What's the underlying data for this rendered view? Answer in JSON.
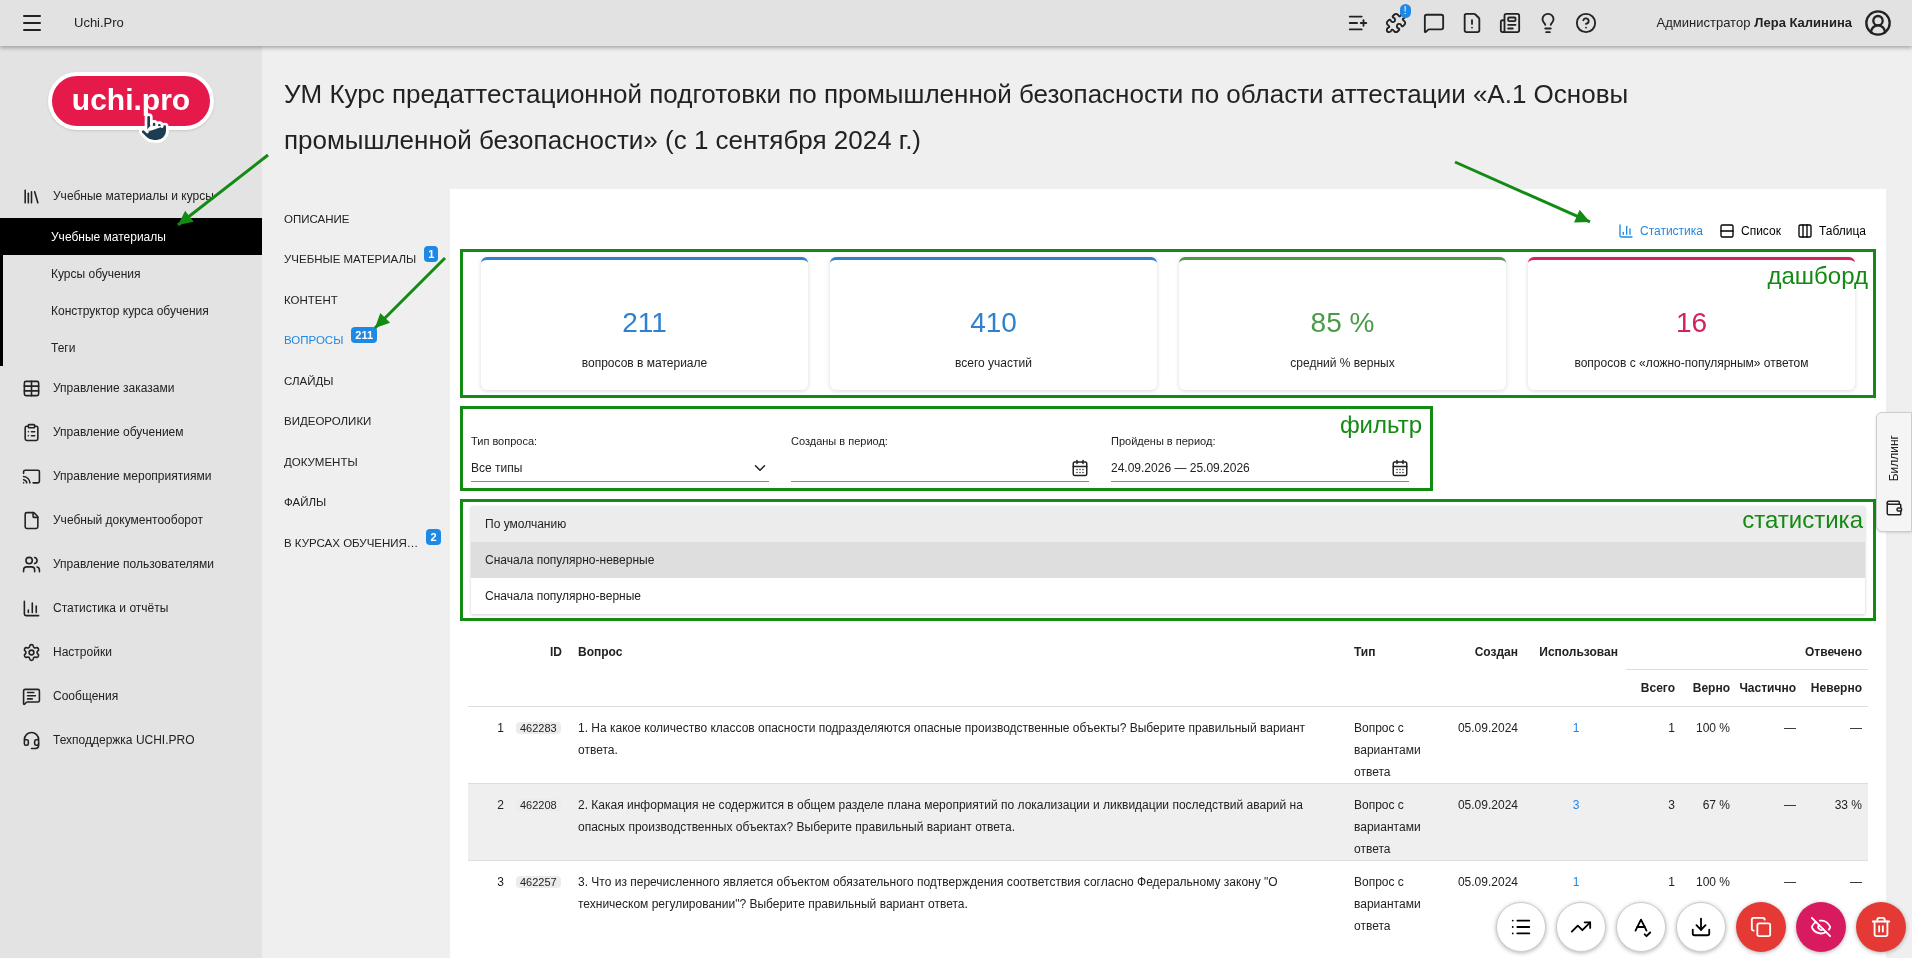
{
  "topbar": {
    "app_name": "Uchi.Pro",
    "icons": [
      {
        "kind": "list-add"
      },
      {
        "kind": "puzzle",
        "badge": "!"
      },
      {
        "kind": "message"
      },
      {
        "kind": "alert-doc"
      },
      {
        "kind": "news"
      },
      {
        "kind": "bulb"
      },
      {
        "kind": "help"
      }
    ],
    "user_role": "Администратор",
    "user_name": "Лера Калинина"
  },
  "logo": {
    "text": "uchi.pro"
  },
  "sidebar": {
    "items": [
      {
        "label": "Учебные материалы и курсы",
        "kind": "library",
        "selected": false,
        "children": [
          {
            "label": "Учебные материалы",
            "selected": true
          },
          {
            "label": "Курсы обучения",
            "selected": false
          },
          {
            "label": "Конструктор курса обучения",
            "selected": false
          },
          {
            "label": "Теги",
            "selected": false
          }
        ]
      },
      {
        "label": "Управление заказами",
        "kind": "table",
        "selected": false
      },
      {
        "label": "Управление обучением",
        "kind": "clipboard",
        "selected": false
      },
      {
        "label": "Управление мероприятиями",
        "kind": "cast",
        "selected": false
      },
      {
        "label": "Учебный документооборот",
        "kind": "file",
        "selected": false
      },
      {
        "label": "Управление пользователями",
        "kind": "users",
        "selected": false
      },
      {
        "label": "Статистика и отчёты",
        "kind": "chart",
        "selected": false
      },
      {
        "label": "Настройки",
        "kind": "gear",
        "selected": false
      },
      {
        "label": "Сообщения",
        "kind": "message",
        "selected": false
      },
      {
        "label": "Техподдержка UCHI.PRO",
        "kind": "headset",
        "selected": false
      }
    ]
  },
  "title": "УМ Курс предаттестационной подготовки по промышленной безопасности по области аттестации «А.1 Основы промышленной безопасности» (с 1 сентября 2024 г.)",
  "tabs": [
    {
      "label": "ОПИСАНИЕ",
      "selected": false
    },
    {
      "label": "УЧЕБНЫЕ МАТЕРИАЛЫ",
      "selected": false,
      "badge": "1"
    },
    {
      "label": "КОНТЕНТ",
      "selected": false
    },
    {
      "label": "ВОПРОСЫ",
      "selected": true,
      "badge": "211"
    },
    {
      "label": "СЛАЙДЫ",
      "selected": false
    },
    {
      "label": "ВИДЕОРОЛИКИ",
      "selected": false
    },
    {
      "label": "ДОКУМЕНТЫ",
      "selected": false
    },
    {
      "label": "ФАЙЛЫ",
      "selected": false
    },
    {
      "label": "В КУРСАХ ОБУЧЕНИЯ…",
      "selected": false,
      "badge": "2"
    }
  ],
  "view_modes": [
    {
      "label": "Статистика",
      "kind": "chart",
      "selected": true
    },
    {
      "label": "Список",
      "kind": "list",
      "selected": false
    },
    {
      "label": "Таблица",
      "kind": "columns",
      "selected": false
    }
  ],
  "dashboard": {
    "annotation": "дашборд",
    "cards": [
      {
        "value": "211",
        "label": "вопросов в материале",
        "color": "#2f80d0"
      },
      {
        "value": "410",
        "label": "всего участий",
        "color": "#2f80d0"
      },
      {
        "value": "85 %",
        "label": "средний % верных",
        "color": "#4a9a4a"
      },
      {
        "value": "16",
        "label": "вопросов с «ложно-популярным» ответом",
        "color": "#d0245a"
      }
    ]
  },
  "filter": {
    "annotation": "фильтр",
    "fields": [
      {
        "kind": "select",
        "label": "Тип вопроса:",
        "value": "Все типы"
      },
      {
        "kind": "date",
        "label": "Созданы в период:"
      },
      {
        "kind": "date",
        "label": "Пройдены в период:",
        "value": "24.09.2026 — 25.09.2026"
      }
    ]
  },
  "sorting": {
    "annotation": "статистика",
    "value": "По умолчанию",
    "options": [
      {
        "label": "Сначала популярно-неверные",
        "selected": true
      },
      {
        "label": "Сначала популярно-верные",
        "selected": false
      }
    ]
  },
  "table": {
    "columns": [
      "ID",
      "Вопрос",
      "Тип",
      "Создан",
      "Использован"
    ],
    "group": "Отвечено",
    "subcolumns": [
      "Всего",
      "Верно",
      "Частично",
      "Неверно"
    ],
    "rows": [
      {
        "n": "1",
        "id": "462283",
        "question": "1. На какое количество классов опасности подразделяются опасные производственные объекты? Выберите правильный вариант ответа.",
        "type": "Вопрос с вариантами ответа",
        "created": "05.09.2024",
        "used": "1",
        "total": "1",
        "correct": "100 %",
        "partial": "—",
        "wrong": "—",
        "highlighted": false
      },
      {
        "n": "2",
        "id": "462208",
        "question": "2. Какая информация не содержится в общем разделе плана мероприятий по локализации и ликвидации последствий аварий на опасных производственных объектах? Выберите правильный вариант ответа.",
        "type": "Вопрос с вариантами ответа",
        "created": "05.09.2024",
        "used": "3",
        "total": "3",
        "correct": "67 %",
        "partial": "—",
        "wrong": "33 %",
        "highlighted": true
      },
      {
        "n": "3",
        "id": "462257",
        "question": "3. Что из перечисленного является объектом обязательного подтверждения соответствия согласно Федеральному закону \"О техническом регулировании\"? Выберите правильный вариант ответа.",
        "type": "Вопрос с вариантами ответа",
        "created": "05.09.2024",
        "used": "1",
        "total": "1",
        "correct": "100 %",
        "partial": "—",
        "wrong": "—",
        "highlighted": false
      }
    ]
  },
  "fab": [
    {
      "kind": "list",
      "color": "#ffffff"
    },
    {
      "kind": "chart",
      "color": "#ffffff"
    },
    {
      "kind": "spell",
      "color": "#ffffff"
    },
    {
      "kind": "download",
      "color": "#ffffff"
    },
    {
      "kind": "copy",
      "color": "#e53935"
    },
    {
      "kind": "hide",
      "color": "#d81b60"
    },
    {
      "kind": "delete",
      "color": "#e53935"
    }
  ],
  "billing": {
    "label": "Биллинг"
  }
}
